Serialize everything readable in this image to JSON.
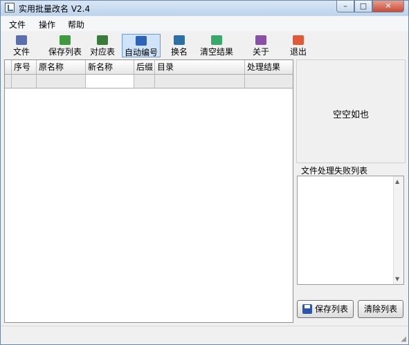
{
  "window": {
    "title": "实用批量改名 V2.4",
    "controls": {
      "minimize": "–",
      "maximize": "□",
      "close": "✕"
    }
  },
  "menu": [
    {
      "label": "文件"
    },
    {
      "label": "操作"
    },
    {
      "label": "帮助"
    }
  ],
  "toolbar": [
    {
      "label": "文件",
      "icon": "file-folder-icon",
      "color": "#5a6fb0"
    },
    {
      "label": "保存列表",
      "icon": "save-list-icon",
      "color": "#3d9b3d"
    },
    {
      "label": "对应表",
      "icon": "mapping-table-icon",
      "color": "#3a7a3a"
    },
    {
      "label": "自动编号",
      "icon": "auto-number-icon",
      "color": "#2e64b8"
    },
    {
      "label": "换名",
      "icon": "hammer-icon",
      "color": "#2f6fa8"
    },
    {
      "label": "清空结果",
      "icon": "clear-results-icon",
      "color": "#3aa86a"
    },
    {
      "label": "关于",
      "icon": "book-icon",
      "color": "#8a4fa6"
    },
    {
      "label": "退出",
      "icon": "exit-icon",
      "color": "#e05a3a"
    }
  ],
  "grid": {
    "columns": [
      "序号",
      "原名称",
      "新名称",
      "后缀",
      "目录",
      "处理结果"
    ]
  },
  "info_panel": {
    "text": "空空如也"
  },
  "fail_panel": {
    "title": "文件处理失败列表",
    "save_button": "保存列表",
    "clear_button": "清除列表"
  }
}
